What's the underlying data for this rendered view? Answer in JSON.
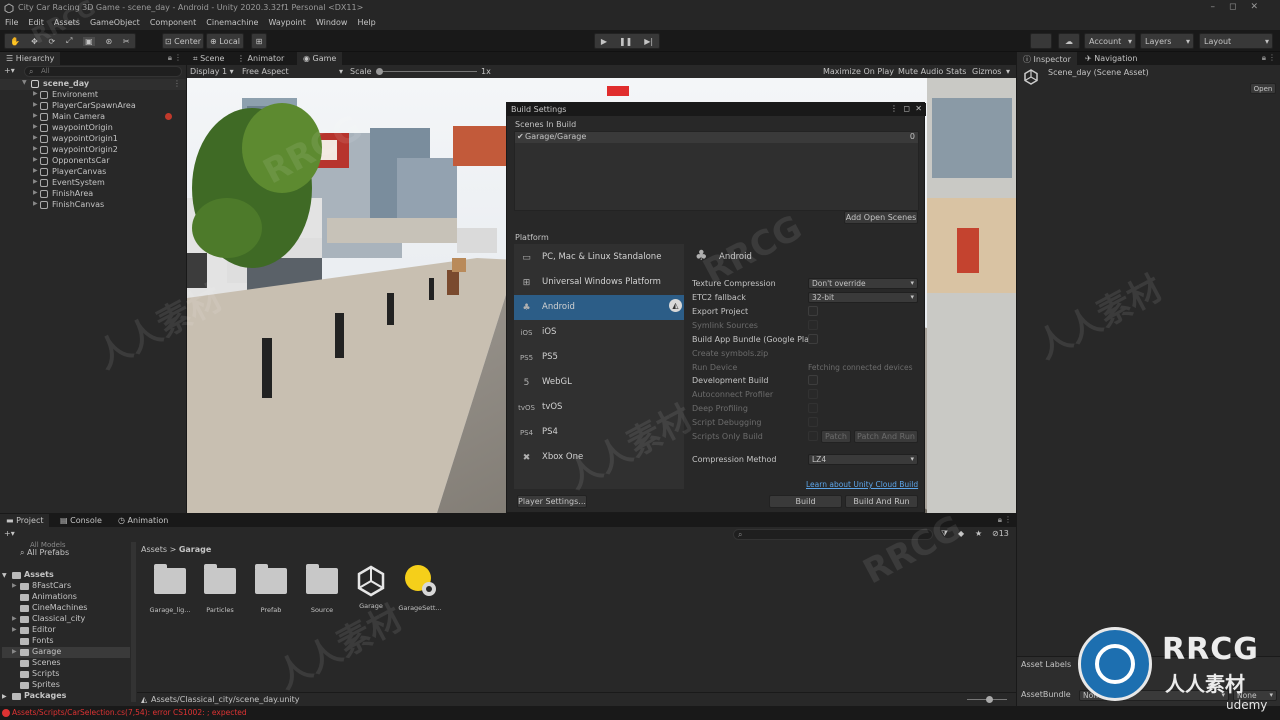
{
  "titlebar": {
    "title": "City Car Racing 3D Game - scene_day - Android - Unity 2020.3.32f1 Personal <DX11>"
  },
  "menu": [
    "File",
    "Edit",
    "Assets",
    "GameObject",
    "Component",
    "Cinemachine",
    "Waypoint",
    "Window",
    "Help"
  ],
  "toolbar": {
    "center": "Center",
    "local": "Local",
    "account": "Account",
    "layers": "Layers",
    "layout": "Layout"
  },
  "hierarchy": {
    "tab": "Hierarchy",
    "search_placeholder": "All",
    "scene": "scene_day",
    "items": [
      "Environemt",
      "PlayerCarSpawnArea",
      "Main Camera",
      "waypointOrigin",
      "waypointOrigin1",
      "waypointOrigin2",
      "OpponentsCar",
      "PlayerCanvas",
      "EventSystem",
      "FinishArea",
      "FinishCanvas"
    ]
  },
  "game": {
    "tabs": [
      "Scene",
      "Animator",
      "Game"
    ],
    "display": "Display 1",
    "aspect": "Free Aspect",
    "scale_label": "Scale",
    "scale_value": "1x",
    "options": [
      "Maximize On Play",
      "Mute Audio",
      "Stats",
      "Gizmos"
    ]
  },
  "build_settings": {
    "title": "Build Settings",
    "scenes_header": "Scenes In Build",
    "scene_entry": "Garage/Garage",
    "scene_index": "0",
    "add_open_scenes": "Add Open Scenes",
    "platform_header": "Platform",
    "platforms": [
      {
        "label": "PC, Mac & Linux Standalone",
        "icon": "monitor-icon",
        "glyph": "▭"
      },
      {
        "label": "Universal Windows Platform",
        "icon": "windows-icon",
        "glyph": "⊞"
      },
      {
        "label": "Android",
        "icon": "android-icon",
        "glyph": "♣"
      },
      {
        "label": "iOS",
        "icon": "ios-icon",
        "glyph": "iOS"
      },
      {
        "label": "PS5",
        "icon": "ps5-icon",
        "glyph": "PS5"
      },
      {
        "label": "WebGL",
        "icon": "html5-icon",
        "glyph": "5"
      },
      {
        "label": "tvOS",
        "icon": "tvos-icon",
        "glyph": "tvOS"
      },
      {
        "label": "PS4",
        "icon": "ps4-icon",
        "glyph": "PS4"
      },
      {
        "label": "Xbox One",
        "icon": "xbox-icon",
        "glyph": "✖"
      }
    ],
    "selected_platform": "Android",
    "settings": {
      "texture_compression": {
        "label": "Texture Compression",
        "value": "Don't override"
      },
      "etc2_fallback": {
        "label": "ETC2 fallback",
        "value": "32-bit"
      },
      "export_project": "Export Project",
      "symlink_sources": "Symlink Sources",
      "build_app_bundle": "Build App Bundle (Google Play)",
      "create_symbols": "Create symbols.zip",
      "run_device": {
        "label": "Run Device",
        "value": "Fetching connected devices"
      },
      "development_build": "Development Build",
      "autoconnect_profiler": "Autoconnect Profiler",
      "deep_profiling": "Deep Profiling",
      "script_debugging": "Script Debugging",
      "scripts_only_build": "Scripts Only Build",
      "patch": "Patch",
      "patch_and_run": "Patch And Run",
      "compression_method": {
        "label": "Compression Method",
        "value": "LZ4"
      }
    },
    "cloud_link": "Learn about Unity Cloud Build",
    "player_settings": "Player Settings...",
    "build": "Build",
    "build_and_run": "Build And Run"
  },
  "inspector": {
    "tabs": [
      "Inspector",
      "Navigation"
    ],
    "asset_title": "Scene_day (Scene Asset)",
    "open_button": "Open",
    "asset_labels": "Asset Labels",
    "asset_bundle_label": "AssetBundle",
    "asset_bundle_value": "None",
    "asset_bundle_variant": "None"
  },
  "project": {
    "tabs": [
      "Project",
      "Console",
      "Animation"
    ],
    "favorites": [
      "All Models",
      "All Prefabs"
    ],
    "breadcrumb": [
      "Assets",
      "Garage"
    ],
    "tree_root": "Assets",
    "tree": [
      "8FastCars",
      "Animations",
      "CineMachines",
      "Classical_city",
      "Editor",
      "Fonts",
      "Garage",
      "Scenes",
      "Scripts",
      "Sprites"
    ],
    "packages": "Packages",
    "assets": [
      {
        "label": "Garage_lig...",
        "type": "folder"
      },
      {
        "label": "Particles",
        "type": "folder"
      },
      {
        "label": "Prefab",
        "type": "folder"
      },
      {
        "label": "Source",
        "type": "folder"
      },
      {
        "label": "Garage",
        "type": "unity-scene"
      },
      {
        "label": "GarageSett...",
        "type": "lighting"
      }
    ],
    "path": "Assets/Classical_city/scene_day.unity",
    "hidden_count": "13"
  },
  "status": {
    "error": "Assets/Scripts/CarSelection.cs(7,54): error CS1002: ; expected"
  },
  "watermarks": [
    "RRCG",
    "人人素材",
    "udemy"
  ]
}
